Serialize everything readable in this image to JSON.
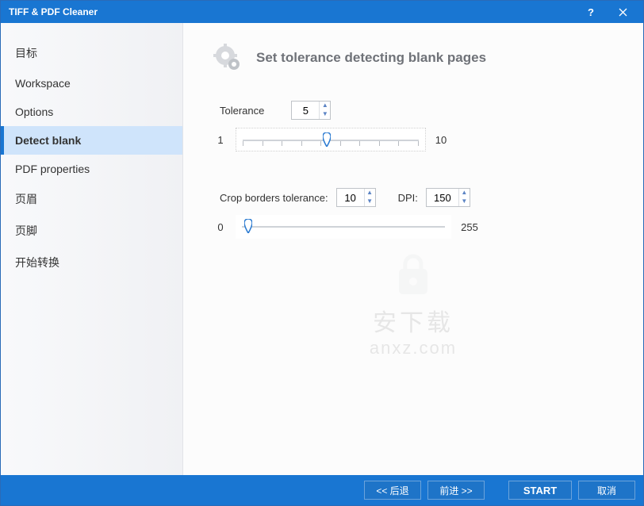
{
  "window": {
    "title": "TIFF & PDF Cleaner"
  },
  "sidebar": {
    "items": [
      {
        "label": "目标"
      },
      {
        "label": "Workspace"
      },
      {
        "label": "Options"
      },
      {
        "label": "Detect blank",
        "selected": true
      },
      {
        "label": "PDF properties"
      },
      {
        "label": "页眉"
      },
      {
        "label": "页脚"
      },
      {
        "label": "开始转换"
      }
    ]
  },
  "main": {
    "title": "Set tolerance detecting blank pages",
    "tolerance": {
      "label": "Tolerance",
      "value": "5",
      "min": "1",
      "max": "10"
    },
    "crop": {
      "label": "Crop borders tolerance:",
      "value": "10",
      "dpi_label": "DPI:",
      "dpi_value": "150",
      "min": "0",
      "max": "255"
    }
  },
  "footer": {
    "back": "<< 后退",
    "forward": "前进 >>",
    "start": "START",
    "cancel": "取消"
  },
  "watermark": {
    "line1": "安下载",
    "line2": "anxz.com"
  }
}
